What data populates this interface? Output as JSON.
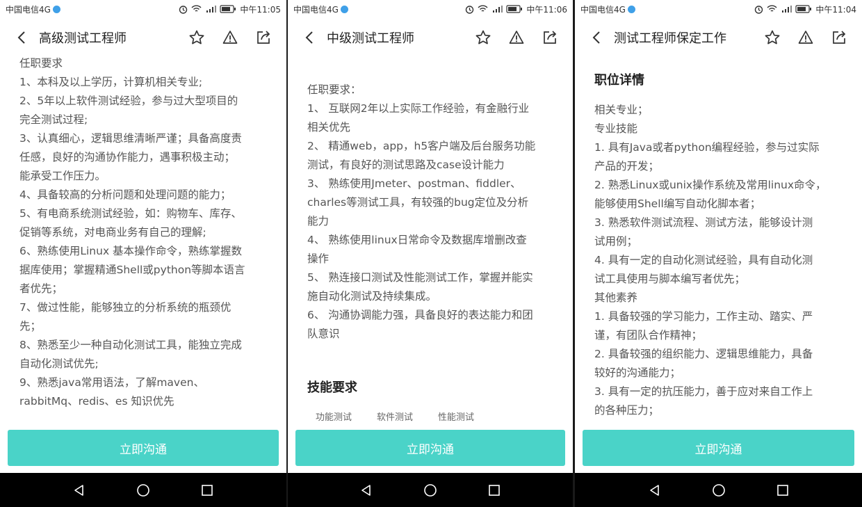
{
  "apply_button_label": "立即沟通",
  "colors": {
    "accent": "#4ad3c8",
    "hd_badge": "#3fa0e8",
    "navbar": "#000000"
  },
  "icons": {
    "back": "chevron-left-icon",
    "favorite": "star-icon",
    "report": "warning-icon",
    "share": "share-icon",
    "nav_back": "triangle-back-icon",
    "nav_home": "circle-home-icon",
    "nav_recent": "square-recent-icon"
  },
  "screens": [
    {
      "status": {
        "carrier": "中国电信4G",
        "time": "中午11:05"
      },
      "title": "高级测试工程师",
      "lines": [
        "任职要求",
        "1、本科及以上学历，计算机相关专业;",
        "2、5年以上软件测试经验，参与过大型项目的",
        "完全测试过程;",
        "3、认真细心，逻辑思维清晰严谨；具备高度责",
        "任感，良好的沟通协作能力，遇事积极主动；",
        "能承受工作压力。",
        "4、具备较高的分析问题和处理问题的能力；",
        "5、有电商系统测试经验，如：购物车、库存、",
        "促销等系统，对电商业务有自己的理解;",
        "6、熟练使用Linux 基本操作命令，熟练掌握数",
        "据库使用；掌握精通Shell或python等脚本语言",
        "者优先；",
        "7、做过性能，能够独立的分析系统的瓶颈优",
        "先；",
        "8、熟悉至少一种自动化测试工具，能独立完成",
        "自动化测试优先;",
        "9、熟悉java常用语法，了解maven、",
        "rabbitMq、redis、es 知识优先"
      ]
    },
    {
      "status": {
        "carrier": "中国电信4G",
        "time": "中午11:06"
      },
      "title": "中级测试工程师",
      "lines": [
        "任职要求：",
        "1、 互联网2年以上实际工作经验，有金融行业",
        "相关优先",
        "2、 精通web，app，h5客户端及后台服务功能",
        "测试，有良好的测试思路及case设计能力",
        "3、 熟练使用Jmeter、postman、fiddler、",
        "charles等测试工具，有较强的bug定位及分析",
        "能力",
        "4、 熟练使用linux日常命令及数据库增删改查",
        "操作",
        "5、 熟连接口测试及性能测试工作，掌握并能实",
        "施自动化测试及持续集成。",
        "6、 沟通协调能力强，具备良好的表达能力和团",
        "队意识"
      ],
      "section_title": "技能要求",
      "skill_tags": [
        "功能测试",
        "软件测试",
        "性能测试"
      ]
    },
    {
      "status": {
        "carrier": "中国电信4G",
        "time": "中午11:04"
      },
      "title": "测试工程师保定工作",
      "section_title": "职位详情",
      "lines": [
        "相关专业；",
        "专业技能",
        "1. 具有Java或者python编程经验，参与过实际",
        "产品的开发；",
        "2. 熟悉Linux或unix操作系统及常用linux命令，",
        "能够使用Shell编写自动化脚本者；",
        "3. 熟悉软件测试流程、测试方法，能够设计测",
        "试用例；",
        "4. 具有一定的自动化测试经验，具有自动化测",
        "试工具使用与脚本编写者优先；",
        "其他素养",
        "1. 具备较强的学习能力，工作主动、踏实、严",
        "谨，有团队合作精神；",
        "2. 具备较强的组织能力、逻辑思维能力，具备",
        "较好的沟通能力；",
        "3. 具有一定的抗压能力，善于应对来自工作上",
        "的各种压力；"
      ]
    }
  ]
}
